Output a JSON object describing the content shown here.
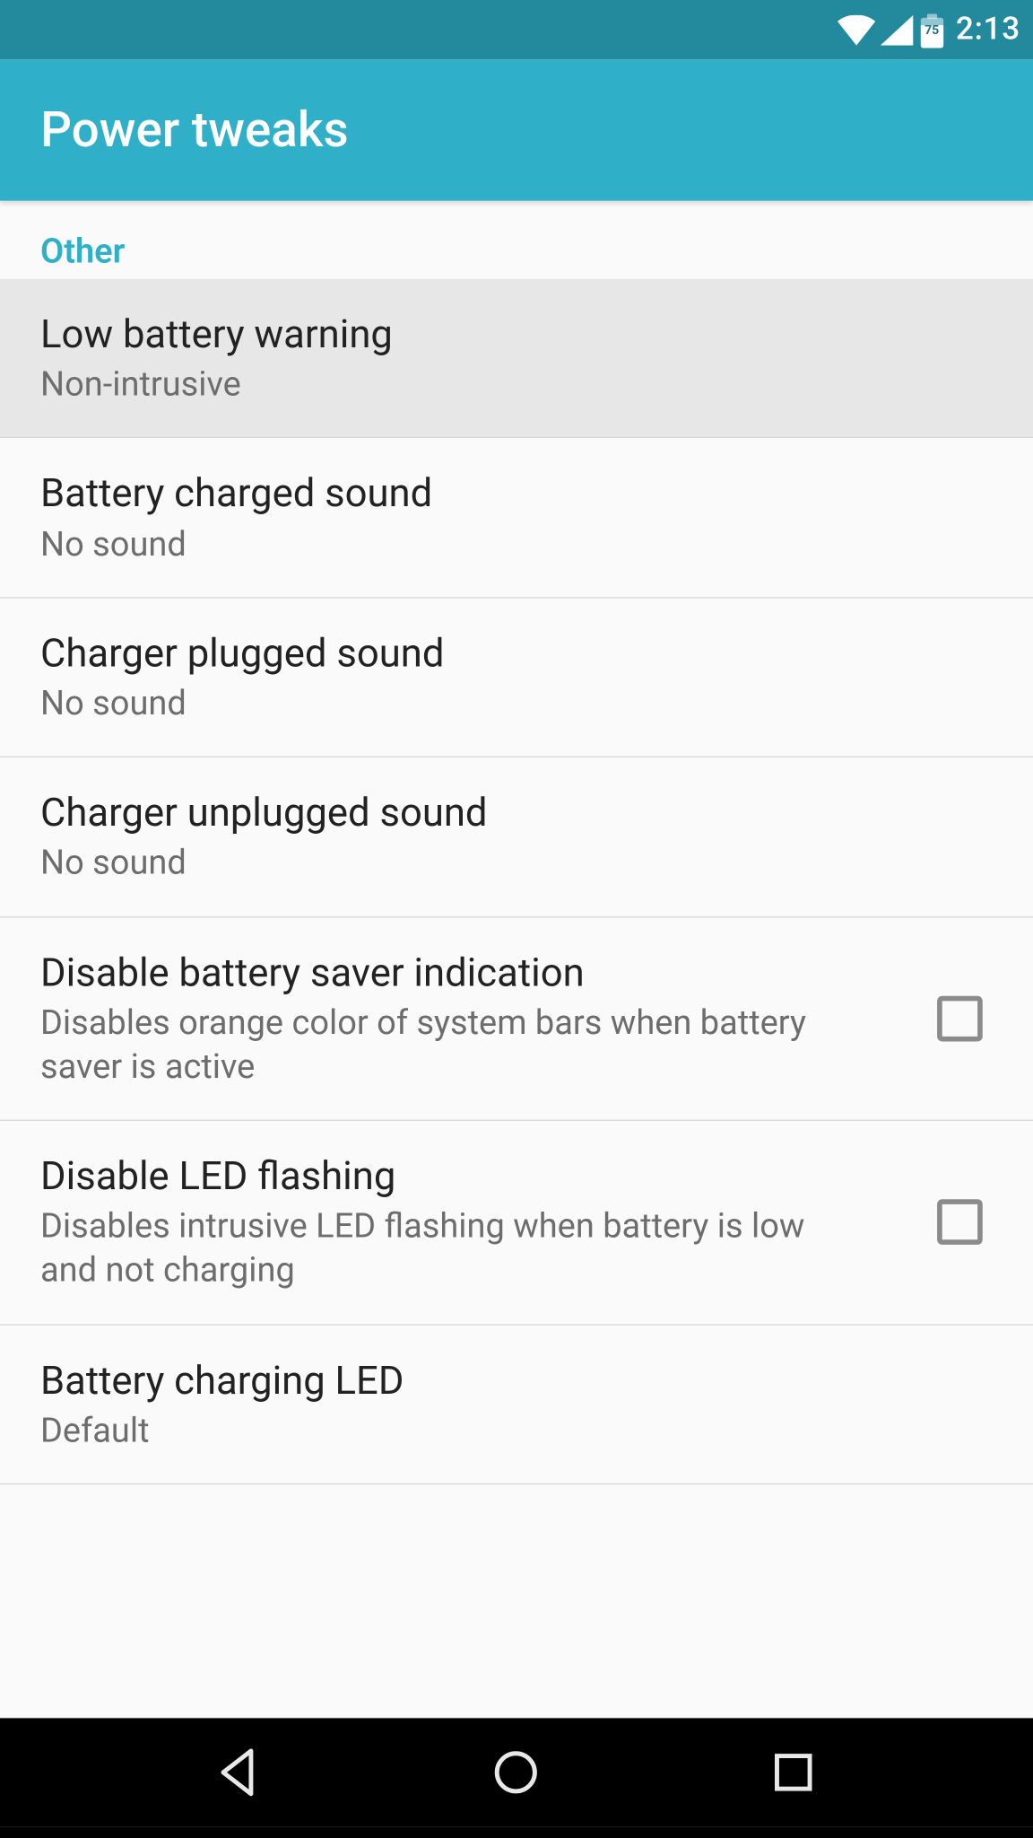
{
  "status": {
    "battery_pct": "75",
    "time": "2:13"
  },
  "appbar": {
    "title": "Power tweaks"
  },
  "section": {
    "header": "Other"
  },
  "prefs": {
    "low_batt": {
      "title": "Low battery warning",
      "summary": "Non-intrusive"
    },
    "charged_sound": {
      "title": "Battery charged sound",
      "summary": "No sound"
    },
    "charger_plugged": {
      "title": "Charger plugged sound",
      "summary": "No sound"
    },
    "charger_unplugged": {
      "title": "Charger unplugged sound",
      "summary": "No sound"
    },
    "disable_saver_ind": {
      "title": "Disable battery saver indication",
      "summary": "Disables orange color of system bars when battery saver is active",
      "checked": false
    },
    "disable_led": {
      "title": "Disable LED flashing",
      "summary": "Disables intrusive LED flashing when battery is low and not charging",
      "checked": false
    },
    "charging_led": {
      "title": "Battery charging LED",
      "summary": "Default"
    }
  },
  "colors": {
    "status_bar": "#238a9e",
    "app_bar": "#2fb0c8",
    "accent": "#2fb0c8",
    "background": "#fafafa",
    "text_primary": "#222222",
    "text_secondary": "#6d6d6d",
    "divider": "#d8d8d8",
    "checkbox_border": "#8b8b8b"
  }
}
